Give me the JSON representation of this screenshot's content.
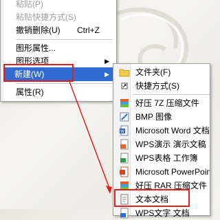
{
  "main_menu": {
    "items": [
      {
        "label": "粘贴(P)",
        "disabled": true
      },
      {
        "label": "粘贴快捷方式(S)",
        "disabled": true
      },
      {
        "label": "撤销删除(U)",
        "shortcut": "Ctrl+Z"
      },
      {
        "label": "图形属性..."
      },
      {
        "label": "图形选项",
        "submenu": true
      },
      {
        "label": "新建(W)",
        "submenu": true
      },
      {
        "label": "属性(R)"
      }
    ]
  },
  "sub_menu": {
    "items": [
      {
        "label": "文件夹(F)",
        "icon": "folder-icon"
      },
      {
        "label": "快捷方式(S)",
        "icon": "shortcut-icon"
      },
      {
        "label": "好压 7Z 压缩文件",
        "icon": "archive-icon"
      },
      {
        "label": "BMP 图像",
        "icon": "bitmap-icon"
      },
      {
        "label": "Microsoft Word 文档",
        "icon": "word-icon"
      },
      {
        "label": "WPS演示 演示文稿",
        "icon": "wps-presentation-icon"
      },
      {
        "label": "WPS表格 工作簿",
        "icon": "wps-spreadsheet-icon"
      },
      {
        "label": "Microsoft PowerPoint",
        "icon": "powerpoint-icon"
      },
      {
        "label": "好压 RAR 压缩文件",
        "icon": "archive-icon"
      },
      {
        "label": "文本文档",
        "icon": "text-document-icon"
      },
      {
        "label": "WPS文字 文档",
        "icon": "wps-document-icon"
      }
    ]
  },
  "colors": {
    "highlight": "#2f6bd1",
    "annotation": "#e02020"
  }
}
